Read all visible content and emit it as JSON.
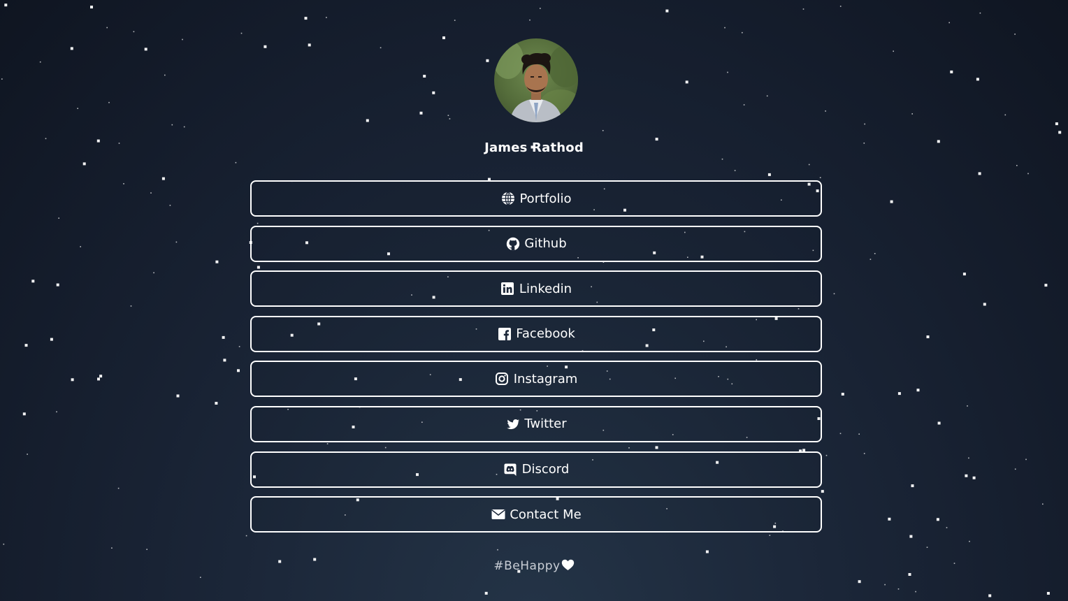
{
  "profile": {
    "name": "James Rathod",
    "avatar_icon": "profile-photo"
  },
  "links": [
    {
      "label": "Portfolio",
      "icon": "globe-icon"
    },
    {
      "label": "Github",
      "icon": "github-icon"
    },
    {
      "label": "Linkedin",
      "icon": "linkedin-icon"
    },
    {
      "label": "Facebook",
      "icon": "facebook-icon"
    },
    {
      "label": "Instagram",
      "icon": "instagram-icon"
    },
    {
      "label": "Twitter",
      "icon": "twitter-icon"
    },
    {
      "label": "Discord",
      "icon": "discord-icon"
    },
    {
      "label": "Contact Me",
      "icon": "envelope-icon"
    }
  ],
  "footer": {
    "text": "#BeHappy",
    "icon": "heart-icon"
  },
  "colors": {
    "background_center": "#243447",
    "background_edge": "#0f1521",
    "button_border": "#ffffff",
    "text": "#ffffff"
  }
}
